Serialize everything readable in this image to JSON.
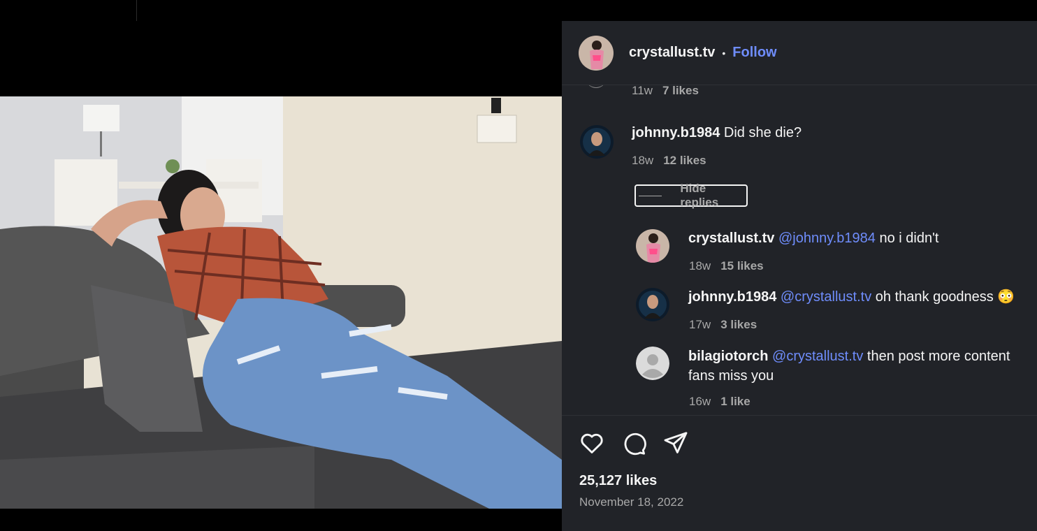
{
  "post": {
    "author": "crystallust.tv",
    "separator": "•",
    "follow_label": "Follow",
    "likes": "25,127 likes",
    "date": "November 18, 2022"
  },
  "prev_comment": {
    "time": "11w",
    "likes": "7 likes"
  },
  "comments": [
    {
      "user": "johnny.b1984",
      "text": "Did she die?",
      "time": "18w",
      "likes": "12 likes",
      "hide_replies_label": "Hide replies",
      "replies": [
        {
          "user": "crystallust.tv",
          "mention": "@johnny.b1984",
          "text": "no i didn't",
          "time": "18w",
          "likes": "15 likes"
        },
        {
          "user": "johnny.b1984",
          "mention": "@crystallust.tv",
          "text": "oh thank goodness 😳",
          "time": "17w",
          "likes": "3 likes"
        },
        {
          "user": "bilagiotorch",
          "mention": "@crystallust.tv",
          "text": "then post more content fans miss you",
          "time": "16w",
          "likes": "1 like"
        }
      ]
    }
  ],
  "icons": {
    "like": "heart-icon",
    "comment": "comment-bubble-icon",
    "share": "paper-plane-icon"
  },
  "colors": {
    "panel_bg": "#212328",
    "link_blue": "#6f8dfc",
    "muted_text": "#a8a8a8"
  }
}
